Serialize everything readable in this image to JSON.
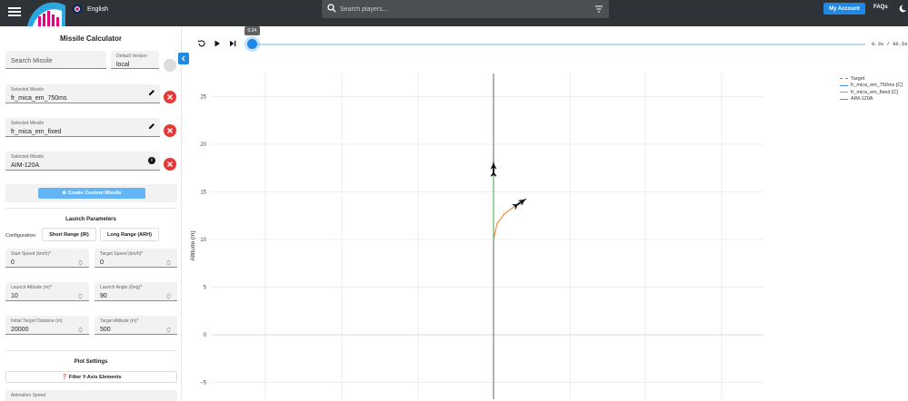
{
  "topbar": {
    "language": "English",
    "search": {
      "placeholder": "Search players..."
    },
    "account_label": "My Account",
    "faq_label": "FAQs"
  },
  "sidebar": {
    "title": "Missile Calculator",
    "search_missile": {
      "placeholder": "Search Missile"
    },
    "default_version": {
      "label": "Default Version",
      "value": "local"
    },
    "selected": [
      {
        "label": "Selected Missile",
        "value": "fr_mica_em_750ms",
        "icon": "edit-icon"
      },
      {
        "label": "Selected Missile",
        "value": "fr_mica_em_fixed",
        "icon": "edit-icon"
      },
      {
        "label": "Selected Missile",
        "value": "AIM-120A",
        "icon": "info-icon"
      }
    ],
    "create_custom_label": "Create Custom Missile",
    "launch_params_title": "Launch Parameters",
    "configuration_label": "Configuration:",
    "config_buttons": [
      "Short Range (IR)",
      "Long Range (ARH)"
    ],
    "params": [
      {
        "label": "Start Speed (km/h)*",
        "value": "0"
      },
      {
        "label": "Target Speed (km/h)*",
        "value": "0"
      },
      {
        "label": "Launch Altitude (m)*",
        "value": "10"
      },
      {
        "label": "Launch Angle (Deg)*",
        "value": "90"
      },
      {
        "label": "Initial Target Distance (m)",
        "value": "20000"
      },
      {
        "label": "Target Altitude (m)*",
        "value": "500"
      }
    ],
    "plot_settings_title": "Plot Settings",
    "filter_label": "Filter Y-Axis Elements",
    "animation_speed_label": "Animation Speed"
  },
  "player": {
    "tooltip": "0.34",
    "progress": 0.0035,
    "time_readout": "0.3s / 96.5s"
  },
  "chart_data": {
    "type": "line",
    "ylabel": "Altitude (m)",
    "yticks": [
      25,
      20,
      15,
      10,
      5,
      0,
      -5
    ],
    "ylim": [
      -6,
      27.5
    ],
    "grid": true,
    "legend_position": "top-right",
    "series": [
      {
        "name": "Target",
        "color": "#888888",
        "dashed": true,
        "points": []
      },
      {
        "name": "fr_mica_em_750ms [C]",
        "color": "#4a90e2",
        "points": []
      },
      {
        "name": "fr_mica_em_fixed [C]",
        "color": "#e8862a",
        "points": [
          [
            0,
            10
          ],
          [
            0.2,
            11.7
          ],
          [
            0.6,
            12.7
          ],
          [
            1.1,
            13.4
          ],
          [
            1.5,
            13.9
          ]
        ]
      },
      {
        "name": "AIM-120A",
        "color": "#4caf50",
        "points": [
          [
            0,
            10
          ],
          [
            0,
            12.5
          ],
          [
            0,
            15
          ],
          [
            0,
            17.5
          ]
        ]
      }
    ]
  }
}
